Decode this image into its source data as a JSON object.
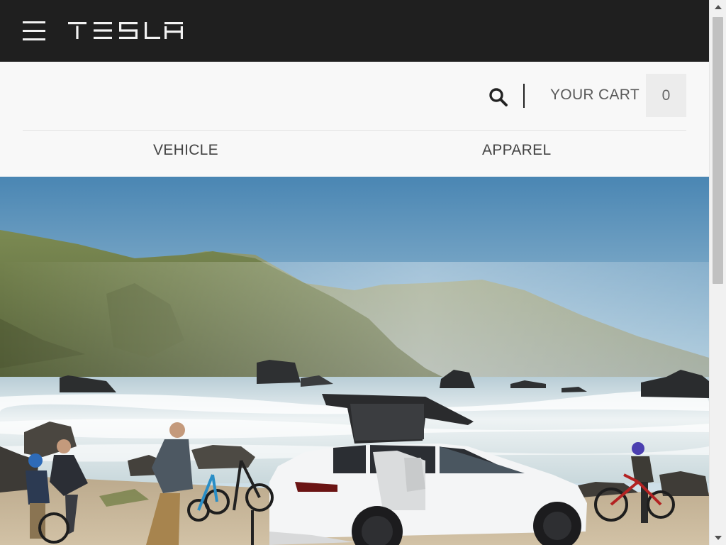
{
  "header": {
    "brand": "TESLA",
    "menu_icon": "hamburger-menu-icon"
  },
  "utility": {
    "search_icon": "search-icon",
    "cart_label": "YOUR CART",
    "cart_count": "0"
  },
  "categories": [
    {
      "label": "VEHICLE"
    },
    {
      "label": "APPAREL"
    }
  ],
  "hero": {
    "description_icon": "hero-photo",
    "colors": {
      "sky_top": "#4a86b3",
      "sky_bottom": "#d9e7ee",
      "hill": "#6d7a46",
      "sea": "#cfdfe4",
      "sand": "#c8b59a",
      "car": "#f4f5f6"
    }
  },
  "colors": {
    "topbar": "#1f1f1f",
    "page_bg": "#f8f8f8",
    "cart_badge_bg": "#ececec",
    "text": "#444444"
  }
}
